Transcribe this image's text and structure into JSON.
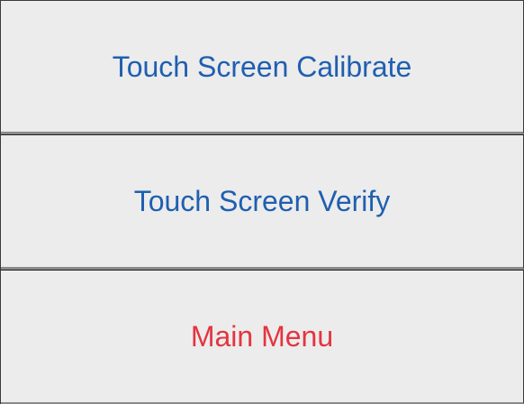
{
  "menu": {
    "items": [
      {
        "label": "Touch Screen Calibrate",
        "color": "#1f5fb0"
      },
      {
        "label": "Touch Screen Verify",
        "color": "#1f5fb0"
      },
      {
        "label": "Main Menu",
        "color": "#e4343f"
      }
    ]
  }
}
